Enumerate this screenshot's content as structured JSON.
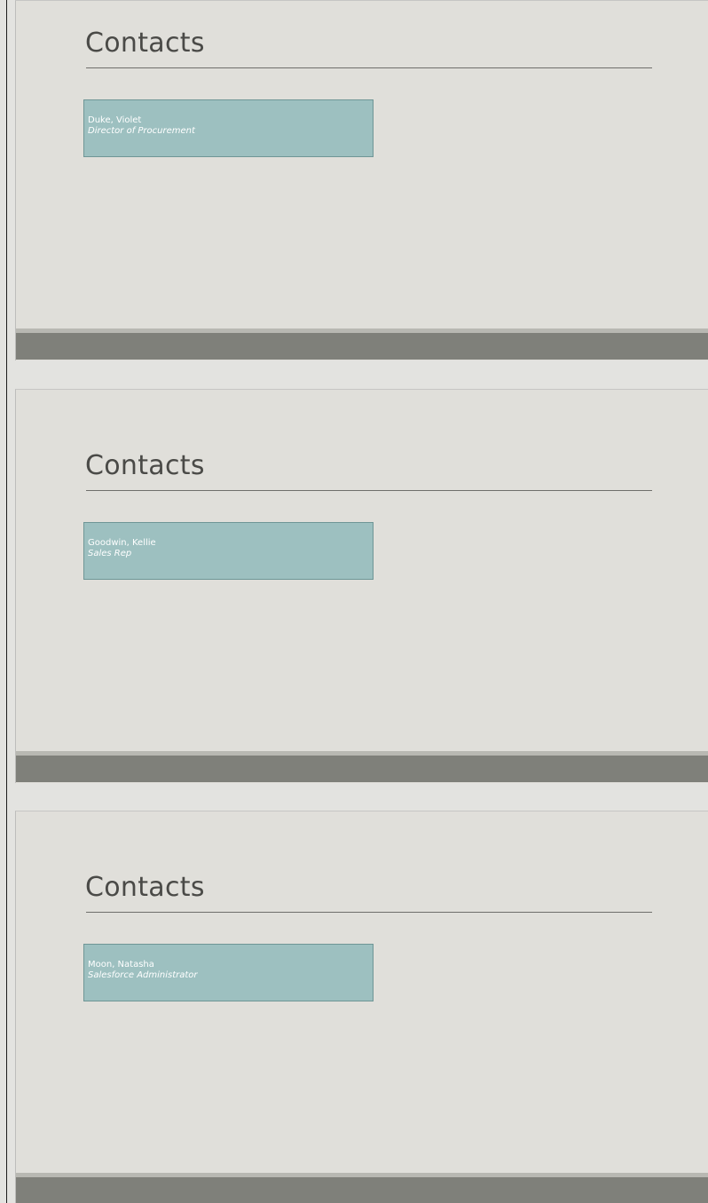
{
  "slides": [
    {
      "title": "Contacts",
      "contact": {
        "name": "Duke, Violet",
        "role": "Director of Procurement"
      }
    },
    {
      "title": "Contacts",
      "contact": {
        "name": "Goodwin, Kellie",
        "role": "Sales Rep"
      }
    },
    {
      "title": "Contacts",
      "contact": {
        "name": "Moon, Natasha",
        "role": "Salesforce Administrator"
      }
    }
  ],
  "colors": {
    "slide_background": "#e0dfda",
    "card_background": "#9dc0c0",
    "footer_bar": "#7f807a",
    "title_text": "#4a4a47"
  }
}
